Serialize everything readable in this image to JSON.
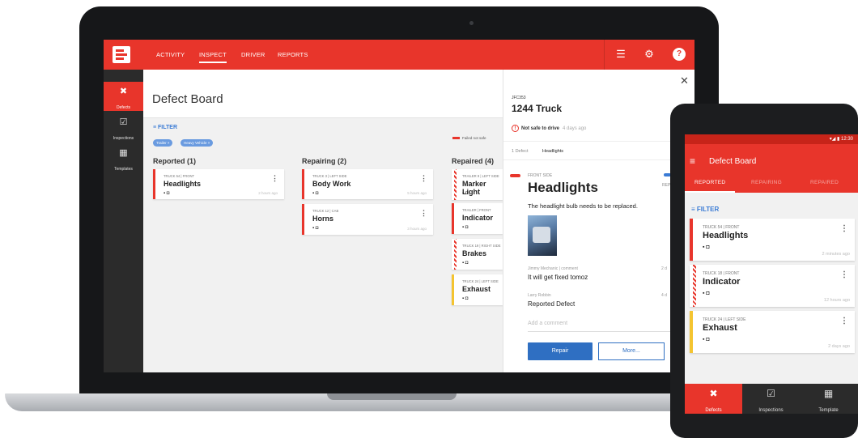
{
  "topbar": {
    "nav": [
      "ACTIVITY",
      "INSPECT",
      "DRIVER",
      "REPORTS"
    ],
    "active_nav": "INSPECT",
    "help_label": "?"
  },
  "sidebar": {
    "items": [
      {
        "label": "Defects",
        "icon": "wrench-icon"
      },
      {
        "label": "Inspections",
        "icon": "clipboard-icon"
      },
      {
        "label": "Templates",
        "icon": "calculator-icon"
      }
    ]
  },
  "board": {
    "title": "Defect Board",
    "filter_label": "FILTER",
    "chips": [
      "Trailer ×",
      "Heavy Vehicle ×"
    ],
    "legend": "Failed not safe",
    "columns": [
      {
        "title": "Reported (1)",
        "cards": [
          {
            "meta": "TRUCK 54 | FRONT",
            "name": "Headlights",
            "ago": "2 hours ago",
            "style": "solid"
          }
        ]
      },
      {
        "title": "Repairing (2)",
        "cards": [
          {
            "meta": "TRUCK 3 | LEFT SIDE",
            "name": "Body Work",
            "ago": "5 hours ago",
            "style": "solid"
          },
          {
            "meta": "TRUCK 12 | CAB",
            "name": "Horns",
            "ago": "3 hours ago",
            "style": "solid"
          }
        ]
      },
      {
        "title": "Repaired (4)",
        "cards": [
          {
            "meta": "TRAILER 9 | LEFT SIDE",
            "name": "Marker Light",
            "style": "striped"
          },
          {
            "meta": "TRAILER | FRONT",
            "name": "Indicator",
            "style": "solid"
          },
          {
            "meta": "TRUCK 19 | RIGHT SIDE",
            "name": "Brakes",
            "style": "striped"
          },
          {
            "meta": "TRUCK 24 | LEFT SIDE",
            "name": "Exhaust",
            "style": "yellow"
          }
        ]
      }
    ]
  },
  "detail": {
    "code": "JFC353",
    "truck": "1244 Truck",
    "status": "Not safe to drive",
    "status_age": "4 days ago",
    "tabs": [
      "1 Defect",
      "Headlights"
    ],
    "location": "FRONT SIDE",
    "rep_label": "REP",
    "defect": "Headlights",
    "description": "The headlight bulb needs to be replaced.",
    "comments": [
      {
        "author": "Jimmy Mechanic | comment",
        "text": "It will get fixed tomoz",
        "day": "2 d"
      },
      {
        "author": "Larry Robbin",
        "text": "Reported Defect",
        "day": "4 d"
      }
    ],
    "comment_placeholder": "Add a comment",
    "repair_label": "Repair",
    "more_label": "More..."
  },
  "phone": {
    "time": "12:30",
    "title": "Defect Board",
    "tabs": [
      "REPORTED",
      "REPAIRING",
      "REPAIRED"
    ],
    "filter_label": "FILTER",
    "cards": [
      {
        "meta": "TRUCK 54 | FRONT",
        "name": "Headlights",
        "ago": "2 minutes ago",
        "style": "solid"
      },
      {
        "meta": "TRUCK 18 | FRONT",
        "name": "Indicator",
        "ago": "12 hours ago",
        "style": "striped"
      },
      {
        "meta": "TRUCK 24 | LEFT SIDE",
        "name": "Exhaust",
        "ago": "2 days ago",
        "style": "yellow"
      }
    ],
    "bottom_nav": [
      "Defects",
      "Inspections",
      "Template"
    ]
  },
  "colors": {
    "accent": "#e8352b",
    "blue": "#2f6fc2",
    "warning": "#f4c430",
    "dark": "#2b2b2b"
  }
}
